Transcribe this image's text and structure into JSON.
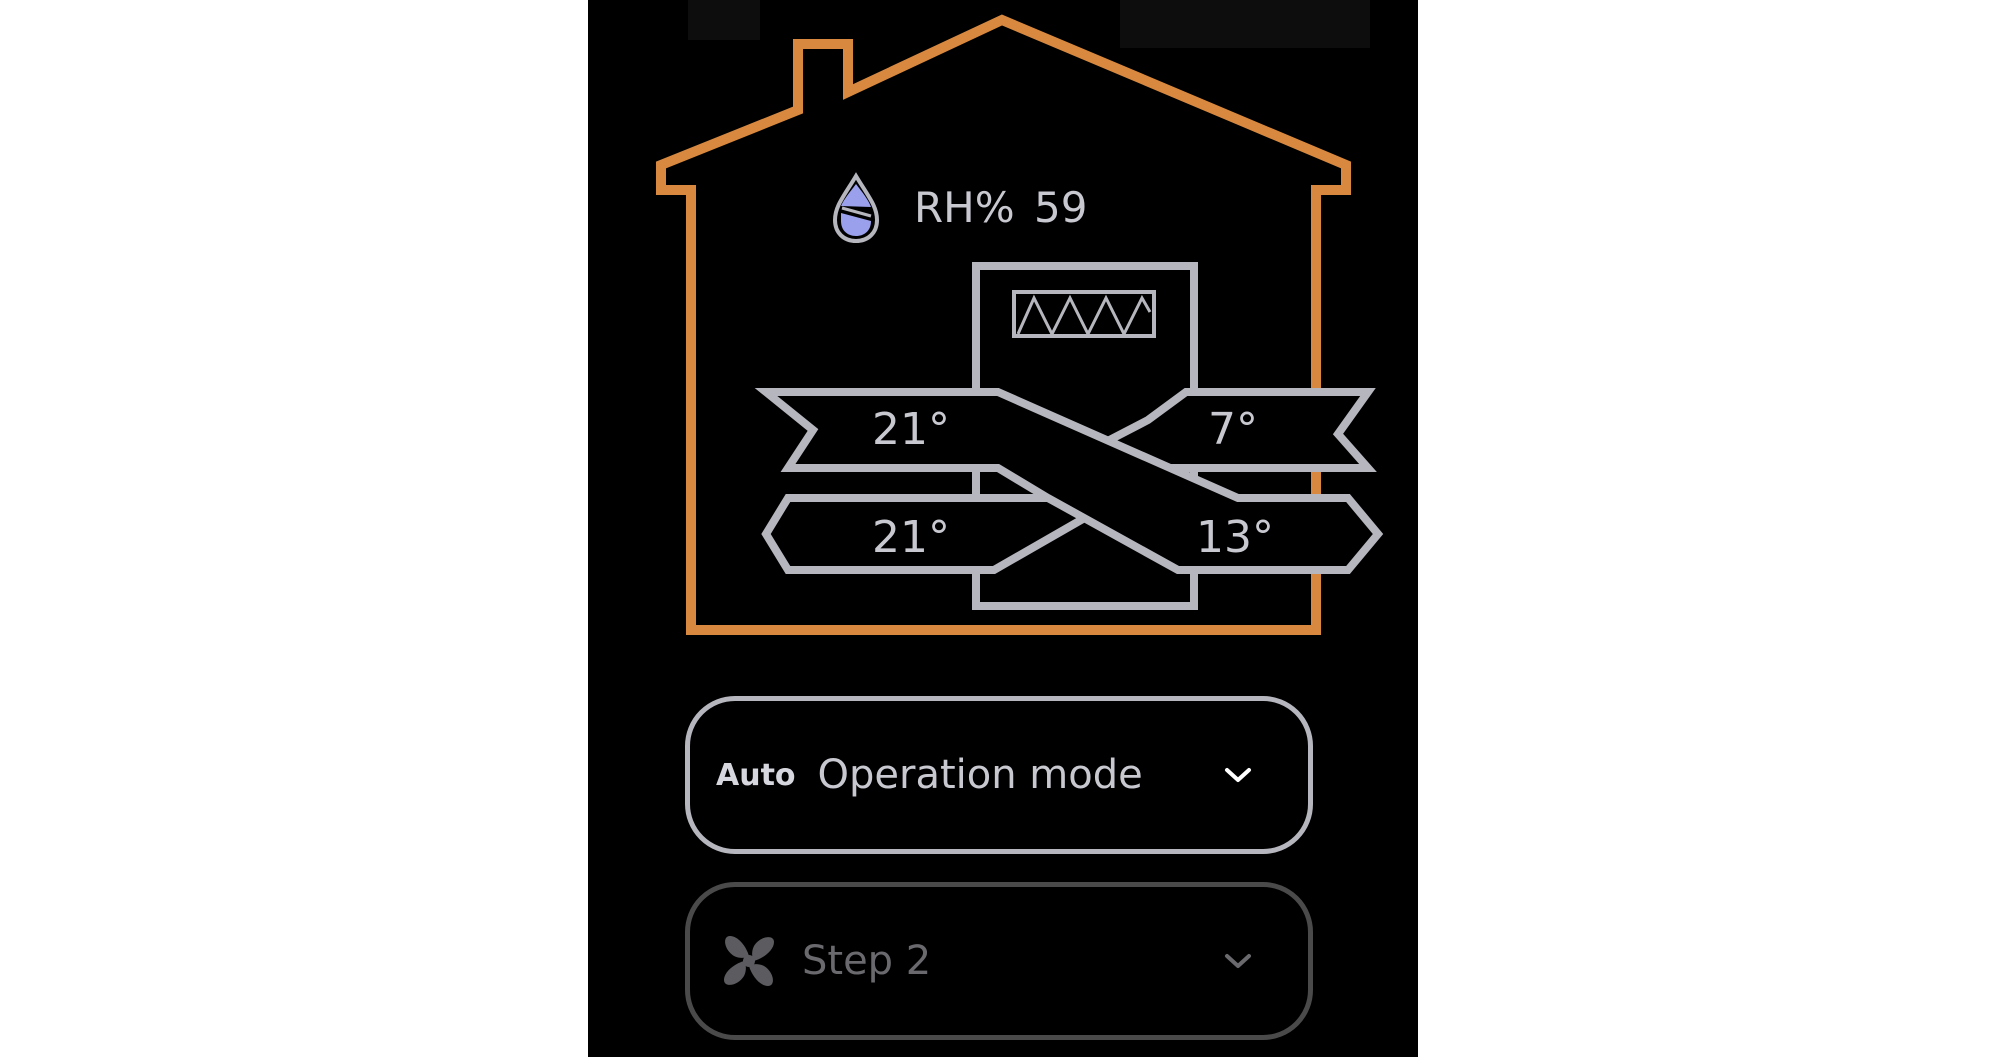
{
  "humidity": {
    "label": "RH%",
    "value": "59",
    "icon": "water-drop-icon"
  },
  "temperatures": {
    "top_left": "21°",
    "top_right": "7°",
    "bottom_left": "21°",
    "bottom_right": "13°"
  },
  "operation_mode": {
    "badge": "Auto",
    "label": "Operation mode",
    "icon": "chevron-down-icon"
  },
  "fan_speed": {
    "label": "Step 2",
    "icon": "fan-icon"
  },
  "colors": {
    "house_outline": "#d9893f",
    "unit_outline": "#b6b6be",
    "text": "#c8c8d0",
    "drop_fill": "#9aa0ec",
    "background": "#000000",
    "disabled": "#4a4a4a"
  }
}
